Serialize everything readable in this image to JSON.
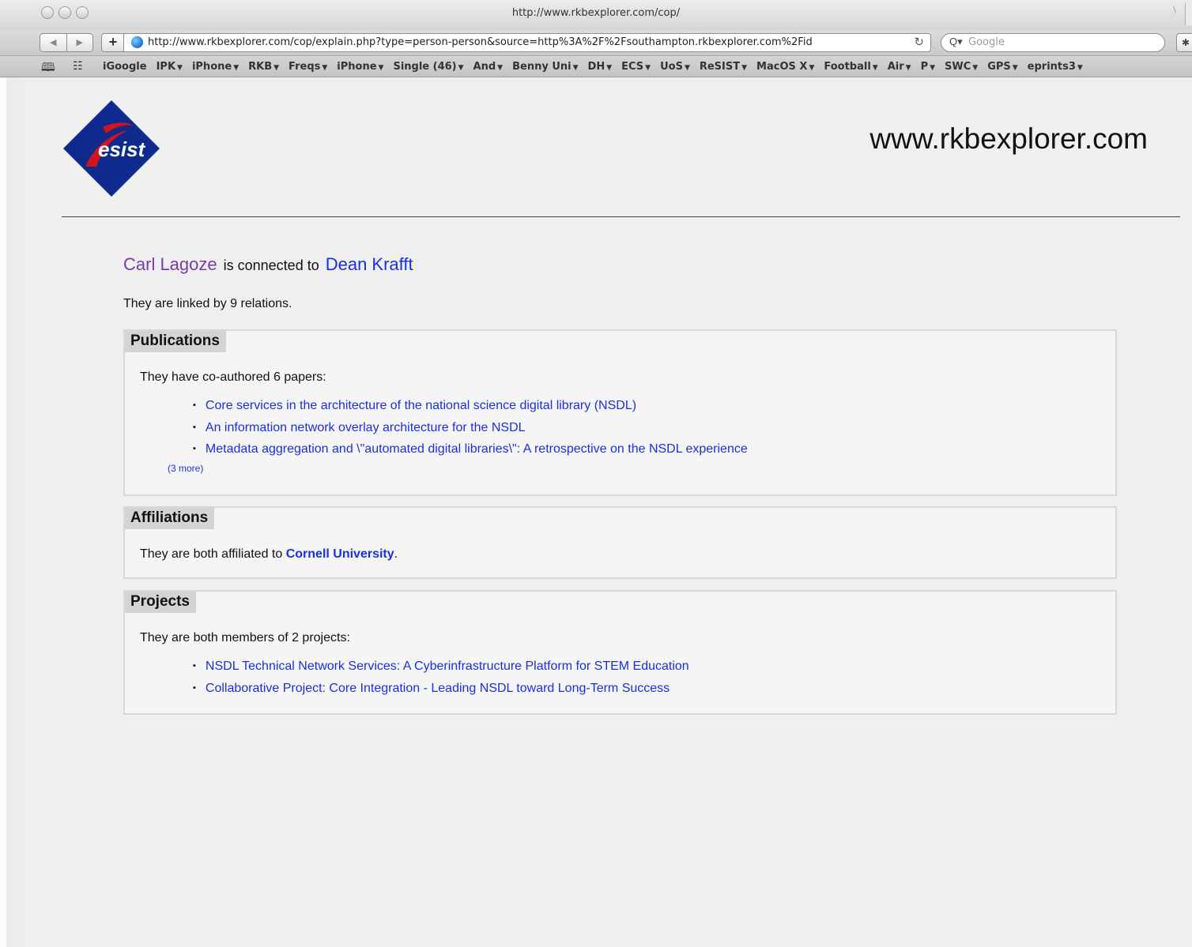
{
  "window": {
    "title": "http://www.rkbexplorer.com/cop/"
  },
  "toolbar": {
    "back_icon": "◀",
    "forward_icon": "▶",
    "add_icon": "+",
    "url": "http://www.rkbexplorer.com/cop/explain.php?type=person-person&source=http%3A%2F%2Fsouthampton.rkbexplorer.com%2Fid",
    "reload_icon": "↻",
    "search_placeholder": "Google",
    "search_icon": "Q▾"
  },
  "bookmarks": [
    {
      "label": "iGoogle",
      "menu": false
    },
    {
      "label": "IPK",
      "menu": true
    },
    {
      "label": "iPhone",
      "menu": true
    },
    {
      "label": "RKB",
      "menu": true
    },
    {
      "label": "Freqs",
      "menu": true
    },
    {
      "label": "iPhone",
      "menu": true
    },
    {
      "label": "Single (46)",
      "menu": true
    },
    {
      "label": "And",
      "menu": true
    },
    {
      "label": "Benny Uni",
      "menu": true
    },
    {
      "label": "DH",
      "menu": true
    },
    {
      "label": "ECS",
      "menu": true
    },
    {
      "label": "UoS",
      "menu": true
    },
    {
      "label": "ReSIST",
      "menu": true
    },
    {
      "label": "MacOS X",
      "menu": true
    },
    {
      "label": "Football",
      "menu": true
    },
    {
      "label": "Air",
      "menu": true
    },
    {
      "label": "P",
      "menu": true
    },
    {
      "label": "SWC",
      "menu": true
    },
    {
      "label": "GPS",
      "menu": true
    },
    {
      "label": "eprints3",
      "menu": true
    }
  ],
  "colors": {
    "link": "#1a2fe0",
    "visited_link": "#7a3aa8",
    "logo_blue": "#0d2a8c",
    "logo_red": "#d2141e"
  },
  "header": {
    "logo_text": "esist",
    "site_name": "www.rkbexplorer.com"
  },
  "connection": {
    "person_a": "Carl Lagoze",
    "connector": "is connected to",
    "person_b": "Dean Krafft",
    "relations": "They are linked by 9 relations."
  },
  "publications": {
    "title": "Publications",
    "intro": "They have co-authored 6 papers:",
    "items": [
      "Core services in the architecture of the national science digital library (NSDL)",
      "An information network overlay architecture for the NSDL",
      "Metadata aggregation and \\\"automated digital libraries\\\": A retrospective on the NSDL experience"
    ],
    "more": "(3 more)"
  },
  "affiliations": {
    "title": "Affiliations",
    "intro": "They are both affiliated to",
    "org": "Cornell University",
    "suffix": "."
  },
  "projects": {
    "title": "Projects",
    "intro": "They are both members of 2 projects:",
    "items": [
      "NSDL Technical Network Services: A Cyberinfrastructure Platform for STEM Education",
      "Collaborative Project: Core Integration - Leading NSDL toward Long-Term Success"
    ]
  }
}
